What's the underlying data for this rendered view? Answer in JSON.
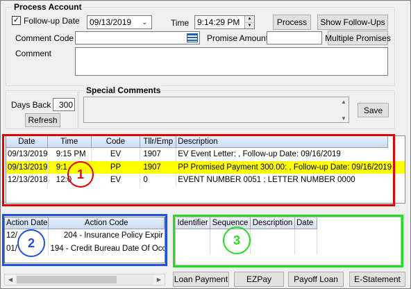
{
  "process_account": {
    "title": "Process Account",
    "followup_label": "Follow-up Date",
    "followup_checked": true,
    "followup_date": "09/13/2019",
    "time_label": "Time",
    "time_value": "9:14:29 PM",
    "process_button": "Process",
    "show_followups_button": "Show Follow-Ups",
    "comment_code_label": "Comment Code",
    "comment_code_value": "",
    "promise_amount_label": "Promise Amount",
    "promise_amount_value": "",
    "multiple_promises_button": "Multiple Promises",
    "comment_label": "Comment",
    "comment_value": ""
  },
  "days_back": {
    "label": "Days Back",
    "value": "300",
    "refresh_button": "Refresh"
  },
  "special_comments": {
    "title": "Special Comments",
    "value": "",
    "save_button": "Save"
  },
  "history_grid": {
    "columns": [
      "Date",
      "Time",
      "Code",
      "Tllr/Emp",
      "Description"
    ],
    "rows": [
      {
        "date": "09/13/2019",
        "time": "9:15 PM",
        "code": "EV",
        "emp": "1907",
        "desc": "EV  Event Letter:  , Follow-up Date: 09/16/2019",
        "selected": false
      },
      {
        "date": "09/13/2019",
        "time": "9:1",
        "code": "PP",
        "emp": "1907",
        "desc": "PP  Promised Payment  300.00:  , Follow-up Date: 09/16/2019",
        "selected": true
      },
      {
        "date": "12/13/2018",
        "time": "12:0",
        "code": "EV",
        "emp": "0",
        "desc": "EVENT NUMBER 0051 ; LETTER NUMBER 0000",
        "selected": false
      }
    ]
  },
  "action_grid": {
    "columns": [
      "Action Date",
      "Action Code"
    ],
    "rows": [
      {
        "date": "12/",
        "code": "204 - Insurance Policy Expir"
      },
      {
        "date": "01/",
        "code": "194 - Credit Bureau Date Of Occu"
      }
    ]
  },
  "identifier_grid": {
    "columns": [
      "Identifier",
      "Sequence",
      "Description",
      "Date"
    ]
  },
  "bottom_buttons": {
    "loan_payment": "Loan Payment",
    "ezpay": "EZPay",
    "payoff_loan": "Payoff Loan",
    "estatement": "E-Statement"
  },
  "annotations": {
    "one": "1",
    "two": "2",
    "three": "3",
    "red": "#e00000",
    "blue": "#2050e0",
    "green": "#22dd22"
  },
  "icons": [
    "checkmark-icon",
    "calendar-dropdown-icon",
    "spin-up-icon",
    "spin-down-icon",
    "list-lookup-icon",
    "scroll-arrow-icon"
  ]
}
